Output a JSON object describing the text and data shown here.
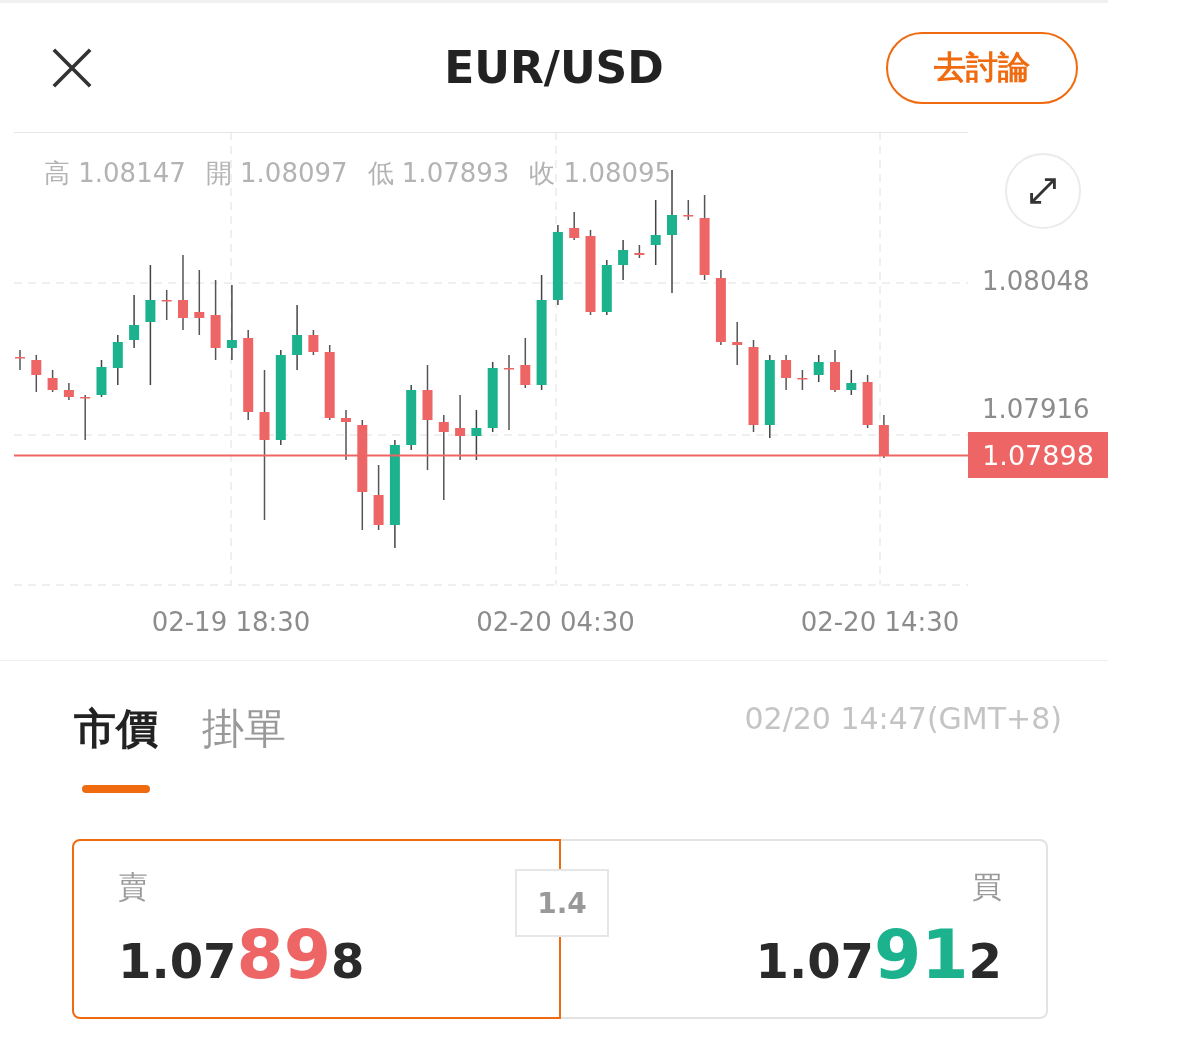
{
  "header": {
    "title": "EUR/USD",
    "discuss_button": "去討論"
  },
  "chart": {
    "ohlc": [
      {
        "label": "高",
        "value": "1.08147"
      },
      {
        "label": "開",
        "value": "1.08097"
      },
      {
        "label": "低",
        "value": "1.07893"
      },
      {
        "label": "收",
        "value": "1.08095"
      }
    ],
    "y_labels": [
      "1.08048",
      "1.07916"
    ],
    "current_price": "1.07898",
    "x_labels": [
      "02-19 18:30",
      "02-20 04:30",
      "02-20 14:30"
    ]
  },
  "tabs": [
    {
      "label": "市價",
      "selected": true
    },
    {
      "label": "掛單",
      "selected": false
    }
  ],
  "timestamp": "02/20 14:47(GMT+8)",
  "quote": {
    "sell": {
      "label": "賣",
      "prefix": "1.07",
      "highlight": "89",
      "suffix": "8",
      "selected": true
    },
    "spread": "1.4",
    "buy": {
      "label": "買",
      "prefix": "1.07",
      "highlight": "91",
      "suffix": "2",
      "selected": false
    }
  }
}
